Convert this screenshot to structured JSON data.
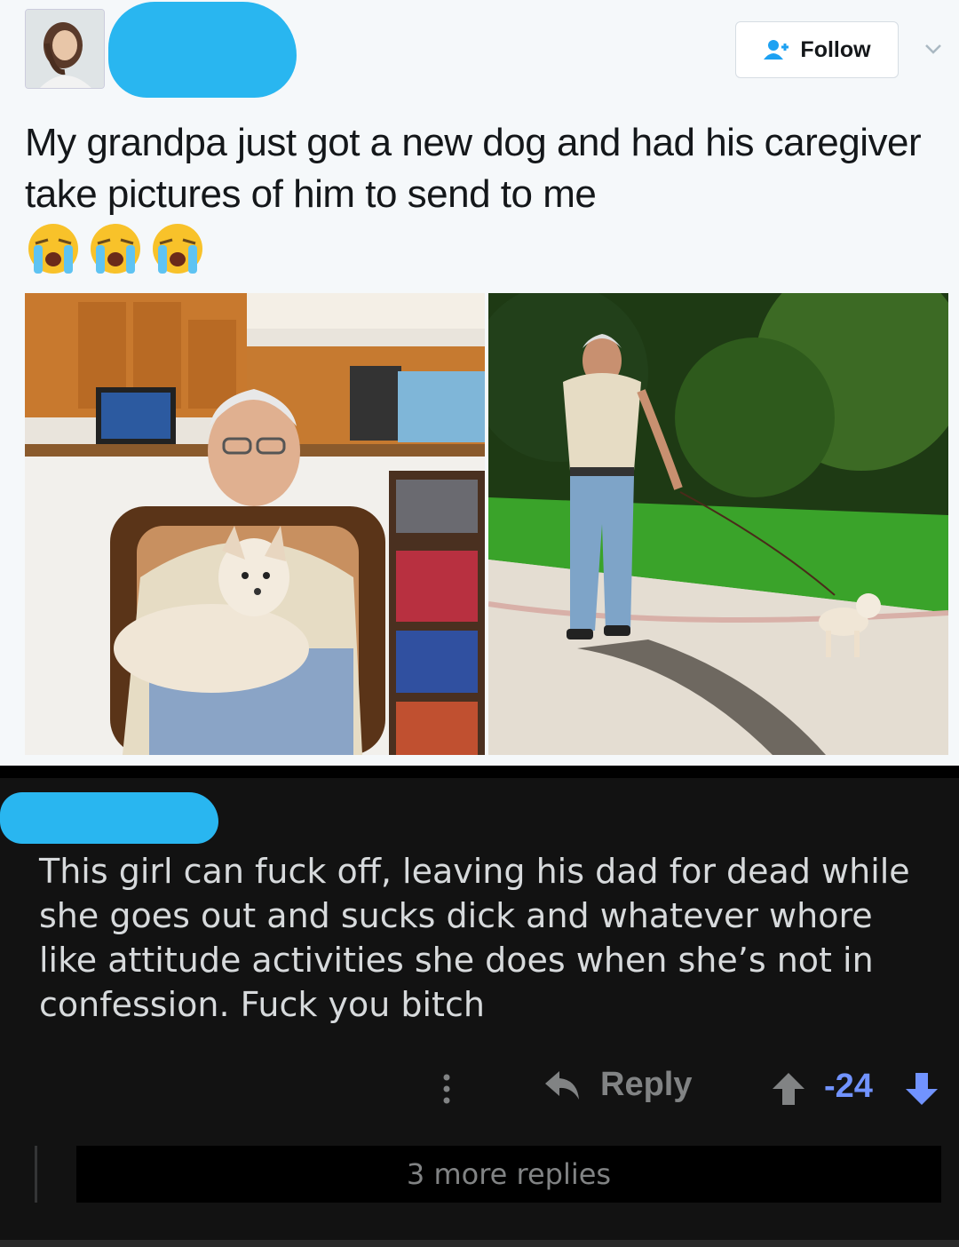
{
  "tweet": {
    "follow_label": "Follow",
    "text": "My grandpa just got a new dog and had his caregiver take pictures of him to send to me",
    "emojis": [
      "loudly-crying-face",
      "loudly-crying-face",
      "loudly-crying-face"
    ]
  },
  "comment": {
    "text": "This girl can fuck off, leaving his dad for dead while she goes out and sucks dick and whatever whore like attitude activities she does when she’s not in confession. Fuck you bitch",
    "reply_label": "Reply",
    "score": "-24",
    "more_replies": "3 more replies"
  },
  "colors": {
    "redaction": "#29b6f0",
    "vote_accent": "#7193ff",
    "dark_bg": "#121212",
    "twitter_blue": "#1da1f2"
  }
}
